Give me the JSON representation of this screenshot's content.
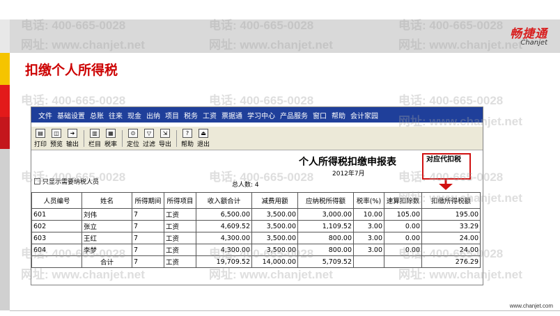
{
  "slide": {
    "title": "扣缴个人所得税",
    "logo_cn": "畅捷通",
    "logo_en": "Chanjet",
    "footer_url": "www.chanjet.com"
  },
  "watermark": {
    "phone": "电话: 400-665-0028",
    "site": "网址: www.chanjet.net"
  },
  "app": {
    "menu": [
      "文件",
      "基础设置",
      "总账",
      "往来",
      "现金",
      "出纳",
      "项目",
      "税务",
      "工资",
      "票据通",
      "学习中心",
      "产品服务",
      "窗口",
      "帮助",
      "会计家园"
    ],
    "toolbar": [
      {
        "label": "打印",
        "icon": "printer-icon",
        "glyph": "▤"
      },
      {
        "label": "预览",
        "icon": "preview-icon",
        "glyph": "◫"
      },
      {
        "label": "输出",
        "icon": "export-icon",
        "glyph": "➜"
      },
      {
        "label": "栏目",
        "icon": "columns-icon",
        "glyph": "▥"
      },
      {
        "label": "税率",
        "icon": "tax-rate-icon",
        "glyph": "▦"
      },
      {
        "label": "定位",
        "icon": "locate-icon",
        "glyph": "⊙"
      },
      {
        "label": "过滤",
        "icon": "filter-icon",
        "glyph": "▽"
      },
      {
        "label": "导出",
        "icon": "export-file-icon",
        "glyph": "⇲"
      },
      {
        "label": "帮助",
        "icon": "help-icon",
        "glyph": "?"
      },
      {
        "label": "退出",
        "icon": "exit-icon",
        "glyph": "⏏"
      }
    ],
    "report": {
      "title": "个人所得税扣缴申报表",
      "period": "2012年7月",
      "only_required_label": "只显示需要纳税人员",
      "total_people": "总人数: 4"
    },
    "table": {
      "headers": [
        "人员编号",
        "姓名",
        "所得期间",
        "所得项目",
        "收入额合计",
        "减费用额",
        "应纳税所得额",
        "税率(%)",
        "速算扣除数",
        "扣缴所得税额"
      ],
      "rows": [
        [
          "601",
          "刘伟",
          "7",
          "工资",
          "6,500.00",
          "3,500.00",
          "3,000.00",
          "10.00",
          "105.00",
          "195.00"
        ],
        [
          "602",
          "张立",
          "7",
          "工资",
          "4,609.52",
          "3,500.00",
          "1,109.52",
          "3.00",
          "0.00",
          "33.29"
        ],
        [
          "603",
          "王红",
          "7",
          "工资",
          "4,300.00",
          "3,500.00",
          "800.00",
          "3.00",
          "0.00",
          "24.00"
        ],
        [
          "604",
          "李梦",
          "7",
          "工资",
          "4,300.00",
          "3,500.00",
          "800.00",
          "3.00",
          "0.00",
          "24.00"
        ],
        [
          "",
          "合计",
          "7",
          "工资",
          "19,709.52",
          "14,000.00",
          "5,709.52",
          "",
          "",
          "276.29"
        ]
      ]
    }
  },
  "annotation": {
    "callout": "对应代扣税"
  },
  "colors": {
    "title_red": "#cc0000",
    "menubar": "#1f3f9a",
    "callout_border": "#d01010"
  }
}
